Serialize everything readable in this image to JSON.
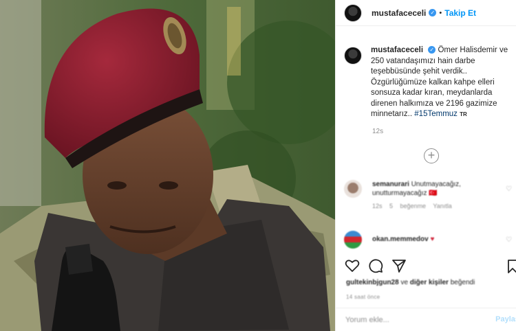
{
  "post": {
    "photo_alt": "soldier-in-red-beret",
    "header": {
      "username": "mustafaceceli",
      "verified_icon": "verified-badge-icon",
      "separator": "•",
      "follow_label": "Takip Et"
    },
    "caption": {
      "username": "mustafaceceli",
      "text": "Ömer Halisdemir ve 250 vatandaşımızı hain darbe teşebbüsünde şehit verdik.. Özgürlüğümüze kalkan kahpe elleri sonsuza kadar kıran, meydanlarda direnen halkımıza ve 2196 gazimize minnetarız..",
      "hashtag": "#15Temmuz",
      "translation_badge": "TR",
      "time": "12s"
    },
    "load_more_icon": "plus-circle-icon",
    "comments": [
      {
        "username": "semanurari",
        "text": "Unutmayacağız, unutturmayacağız 🇹🇷",
        "meta_time": "12s",
        "meta_likes": "5 beğenme",
        "meta_reply": "Yanıtla"
      },
      {
        "username": "okan.memmedov",
        "text": "♥"
      }
    ],
    "actions": {
      "like_icon": "heart-icon",
      "comment_icon": "comment-icon",
      "share_icon": "paper-plane-icon",
      "save_icon": "bookmark-icon"
    },
    "likes": {
      "user": "gultekinbjgun28",
      "middle": "ve",
      "others": "diğer kişiler",
      "suffix": "beğendi"
    },
    "date": "14 saat önce",
    "comment_input": {
      "placeholder": "Yorum ekle...",
      "post_label": "Paylaş"
    },
    "colors": {
      "accent": "#0095f6",
      "beret": "#8c1d2e",
      "hashtag": "#00376b"
    }
  }
}
